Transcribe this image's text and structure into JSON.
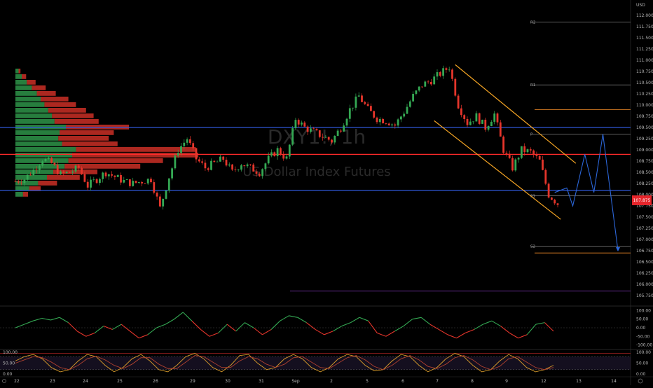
{
  "chart_data": [
    {
      "type": "candlestick",
      "title": "DXY1!, 1h",
      "subtitle": "US Dollar Index Futures",
      "currency": "USD",
      "price_axis_ticks": [
        112.0,
        111.75,
        111.5,
        111.25,
        111.0,
        110.75,
        110.5,
        110.25,
        110.0,
        109.75,
        109.5,
        109.25,
        109.0,
        108.75,
        108.5,
        108.25,
        108.0,
        107.75,
        107.5,
        107.25,
        107.0,
        106.75,
        106.5,
        106.25,
        106.0,
        105.75
      ],
      "price_axis_labels": [
        "112.000",
        "111.750",
        "111.500",
        "111.250",
        "111.000",
        "110.750",
        "110.500",
        "110.250",
        "110.000",
        "109.750",
        "109.500",
        "109.250",
        "109.000",
        "108.750",
        "108.500",
        "108.250",
        "108.000",
        "107.750",
        "107.500",
        "107.250",
        "107.000",
        "106.750",
        "106.500",
        "106.250",
        "106.000",
        "105.750"
      ],
      "ylim": [
        105.5,
        112.2
      ],
      "last_price": "107.875",
      "time_ticks": [
        "22",
        "23",
        "24",
        "25",
        "26",
        "29",
        "30",
        "31",
        "Sep",
        "2",
        "5",
        "6",
        "7",
        "8",
        "9",
        "12",
        "13",
        "14"
      ],
      "close_path": [
        [
          0,
          108.3
        ],
        [
          3,
          108.35
        ],
        [
          6,
          108.55
        ],
        [
          9,
          108.8
        ],
        [
          12,
          108.7
        ],
        [
          15,
          108.45
        ],
        [
          18,
          108.5
        ],
        [
          21,
          108.6
        ],
        [
          24,
          108.2
        ],
        [
          27,
          108.35
        ],
        [
          30,
          108.5
        ],
        [
          33,
          108.4
        ],
        [
          36,
          108.3
        ],
        [
          39,
          108.25
        ],
        [
          42,
          108.3
        ],
        [
          45,
          108.35
        ],
        [
          48,
          107.7
        ],
        [
          51,
          108.4
        ],
        [
          54,
          109.0
        ],
        [
          57,
          109.25
        ],
        [
          60,
          108.8
        ],
        [
          63,
          108.6
        ],
        [
          66,
          108.7
        ],
        [
          69,
          108.8
        ],
        [
          72,
          108.5
        ],
        [
          75,
          108.7
        ],
        [
          78,
          108.6
        ],
        [
          81,
          108.5
        ],
        [
          84,
          108.8
        ],
        [
          87,
          109.0
        ],
        [
          90,
          108.8
        ],
        [
          93,
          109.7
        ],
        [
          96,
          109.5
        ],
        [
          99,
          109.4
        ],
        [
          102,
          109.3
        ],
        [
          105,
          109.2
        ],
        [
          108,
          109.5
        ],
        [
          111,
          109.9
        ],
        [
          114,
          110.2
        ],
        [
          117,
          109.9
        ],
        [
          120,
          109.7
        ],
        [
          123,
          109.65
        ],
        [
          126,
          109.55
        ],
        [
          129,
          109.85
        ],
        [
          132,
          110.2
        ],
        [
          135,
          110.45
        ],
        [
          138,
          110.55
        ],
        [
          141,
          110.7
        ],
        [
          144,
          110.85
        ],
        [
          147,
          110.0
        ],
        [
          150,
          109.6
        ],
        [
          153,
          109.75
        ],
        [
          156,
          109.5
        ],
        [
          159,
          109.8
        ],
        [
          162,
          109.0
        ],
        [
          165,
          108.6
        ],
        [
          168,
          109.0
        ],
        [
          171,
          108.95
        ],
        [
          174,
          108.75
        ],
        [
          177,
          108.0
        ],
        [
          180,
          107.8
        ]
      ],
      "horizontal_levels": {
        "blue": [
          109.5,
          108.1
        ],
        "red": [
          108.9
        ],
        "orange": [
          109.9,
          106.7
        ],
        "purple": [
          105.85
        ]
      },
      "pivot_levels": [
        {
          "label": "R2",
          "value": 111.85
        },
        {
          "label": "R1",
          "value": 110.45
        },
        {
          "label": "P",
          "value": 109.35
        },
        {
          "label": "S1",
          "value": 107.98
        },
        {
          "label": "S2",
          "value": 106.85
        }
      ],
      "channel": {
        "upper": [
          [
            146,
            110.9
          ],
          [
            186,
            108.7
          ]
        ],
        "lower": [
          [
            139,
            109.65
          ],
          [
            181,
            107.45
          ]
        ]
      },
      "projection": [
        [
          179,
          108.05
        ],
        [
          183,
          108.15
        ],
        [
          185,
          107.75
        ],
        [
          189,
          108.9
        ],
        [
          192,
          108.05
        ],
        [
          195,
          109.35
        ],
        [
          200,
          106.75
        ]
      ],
      "volume_profile": {
        "price_levels": [
          110.75,
          110.625,
          110.5,
          110.375,
          110.25,
          110.125,
          110.0,
          109.875,
          109.75,
          109.625,
          109.5,
          109.375,
          109.25,
          109.125,
          109.0,
          108.875,
          108.75,
          108.625,
          108.5,
          108.375,
          108.25,
          108.125,
          108.0
        ],
        "buy": [
          5,
          10,
          18,
          26,
          34,
          40,
          46,
          52,
          58,
          62,
          80,
          70,
          68,
          74,
          96,
          90,
          84,
          78,
          60,
          50,
          36,
          22,
          12
        ],
        "sell": [
          3,
          7,
          14,
          22,
          30,
          44,
          50,
          60,
          66,
          70,
          100,
          86,
          80,
          88,
          190,
          200,
          150,
          120,
          70,
          52,
          30,
          18,
          8
        ]
      }
    },
    {
      "type": "line",
      "name": "oscillator",
      "ylim": [
        -110,
        110
      ],
      "axis_ticks": [
        "100.00",
        "50.00",
        "0.00",
        "-50.00",
        "-100.00"
      ],
      "values": [
        0,
        20,
        40,
        55,
        45,
        60,
        30,
        -20,
        -50,
        -30,
        10,
        -10,
        20,
        -20,
        -60,
        -40,
        0,
        20,
        50,
        90,
        40,
        -10,
        -50,
        -30,
        20,
        -20,
        30,
        0,
        -40,
        -10,
        40,
        70,
        60,
        30,
        -10,
        -40,
        -20,
        10,
        30,
        60,
        40,
        -30,
        -50,
        -20,
        10,
        50,
        60,
        20,
        -10,
        -40,
        -60,
        -30,
        -10,
        20,
        40,
        10,
        -30,
        -60,
        -40,
        20,
        30,
        -20
      ]
    },
    {
      "type": "line",
      "name": "stochastic",
      "ylim": [
        0,
        100
      ],
      "axis_ticks": [
        "100.00",
        "50.00",
        "0.00"
      ],
      "k": [
        60,
        80,
        90,
        70,
        30,
        10,
        20,
        60,
        90,
        80,
        40,
        10,
        30,
        70,
        90,
        60,
        20,
        10,
        40,
        80,
        95,
        70,
        30,
        10,
        40,
        85,
        90,
        50,
        20,
        30,
        70,
        90,
        70,
        30,
        10,
        30,
        70,
        90,
        80,
        40,
        15,
        20,
        60,
        90,
        80,
        40,
        10,
        30,
        70,
        95,
        80,
        40,
        10,
        20,
        60,
        90,
        70,
        30,
        10,
        20,
        40
      ],
      "d": [
        50,
        65,
        80,
        75,
        55,
        30,
        20,
        40,
        70,
        82,
        65,
        40,
        25,
        45,
        75,
        75,
        45,
        25,
        25,
        55,
        85,
        80,
        55,
        30,
        30,
        60,
        80,
        70,
        45,
        30,
        45,
        75,
        80,
        55,
        30,
        25,
        50,
        75,
        85,
        65,
        35,
        20,
        40,
        70,
        85,
        65,
        35,
        25,
        45,
        75,
        85,
        65,
        35,
        20,
        35,
        70,
        80,
        55,
        30,
        20,
        30
      ],
      "levels": [
        80,
        20
      ]
    }
  ],
  "colors": {
    "up": "#34a853",
    "down": "#e5352b",
    "blue_line": "#2f56d6",
    "red_line": "#ff2a2a",
    "orange_line": "#f28c28",
    "purple_line": "#8a3cc6",
    "channel": "#f5a524",
    "projection": "#2c66d8",
    "price_tag": "#e5252b"
  }
}
